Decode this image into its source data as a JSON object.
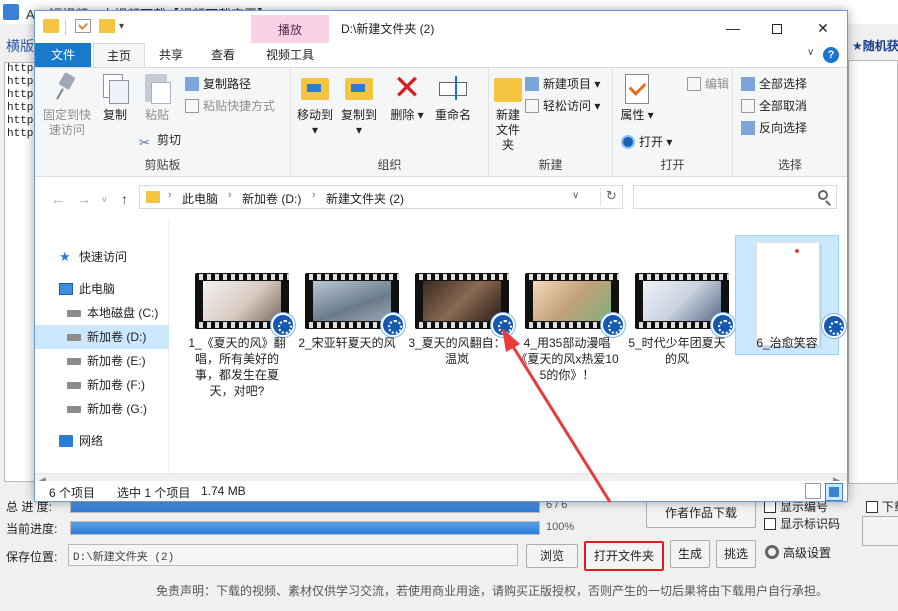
{
  "bg_app": {
    "title": "App短视频、小视频下载【视频下载宝王】",
    "menu_left": "横版",
    "menu_right": "★随机获",
    "url_lines": [
      "https:",
      "https:",
      "https:",
      "https:",
      "https:",
      "https:"
    ],
    "total_progress_label": "总 进 度:",
    "total_progress_text": "6 / 6",
    "total_progress_fraction": 1.0,
    "current_progress_label": "当前进度:",
    "current_progress_text": "100%",
    "current_progress_fraction": 1.0,
    "save_label": "保存位置:",
    "save_path": "D:\\新建文件夹 (2)",
    "browse_label": "浏览",
    "open_folder_label": "打开文件夹",
    "generate_label": "生成",
    "pick_label": "挑选",
    "advanced_label": "高级设置",
    "author_label": "作者作品下载",
    "show_number_label": "显示编号",
    "show_watermark_label": "显示标识码",
    "right_download_label": "下载",
    "disclaimer": "免责声明：下载的视频、素材仅供学习交流，若使用商业用途，请购买正版授权，否则产生的一切后果将由下载用户自行承担。"
  },
  "explorer": {
    "title": "D:\\新建文件夹 (2)",
    "context_tab_header": "播放",
    "tabs": {
      "file": "文件",
      "home": "主页",
      "share": "共享",
      "view": "查看",
      "video_tools": "视频工具"
    },
    "ribbon": {
      "clipboard": {
        "label": "剪贴板",
        "pin": "固定到快速访问",
        "copy": "复制",
        "paste": "粘贴",
        "copy_path": "复制路径",
        "paste_shortcut": "粘贴快捷方式",
        "cut": "剪切"
      },
      "organize": {
        "label": "组织",
        "move_to": "移动到",
        "copy_to": "复制到",
        "delete": "删除",
        "rename": "重命名"
      },
      "new": {
        "label": "新建",
        "new_folder": "新建文件夹",
        "new_item": "新建项目",
        "easy_access": "轻松访问"
      },
      "open": {
        "label": "打开",
        "properties": "属性",
        "open": "打开",
        "edit": "编辑"
      },
      "select": {
        "label": "选择",
        "select_all": "全部选择",
        "select_none": "全部取消",
        "invert": "反向选择"
      }
    },
    "address": {
      "crumbs": [
        "此电脑",
        "新加卷 (D:)",
        "新建文件夹 (2)"
      ]
    },
    "nav": {
      "quick_access": "快速访问",
      "this_pc": "此电脑",
      "drives": [
        "本地磁盘 (C:)",
        "新加卷 (D:)",
        "新加卷 (E:)",
        "新加卷 (F:)",
        "新加卷 (G:)"
      ],
      "network": "网络"
    },
    "files": [
      {
        "name": "1_《夏天的风》翻唱，所有美好的事，都发生在夏天，对吧?"
      },
      {
        "name": "2_宋亚轩夏天的风"
      },
      {
        "name": "3_夏天的风翻自：温岚"
      },
      {
        "name": "4_用35部动漫唱《夏天的风x热爱105的你》！"
      },
      {
        "name": "5_时代少年团夏天的风"
      },
      {
        "name": "6_治愈笑容"
      }
    ],
    "status": {
      "count": "6 个项目",
      "selected": "选中 1 个项目",
      "size": "1.74 MB"
    }
  },
  "colors": {
    "accent_blue": "#1979ca",
    "context_tab_pink": "#f9d2e6",
    "highlight_red": "#e02020",
    "selection": "#cce8ff"
  }
}
